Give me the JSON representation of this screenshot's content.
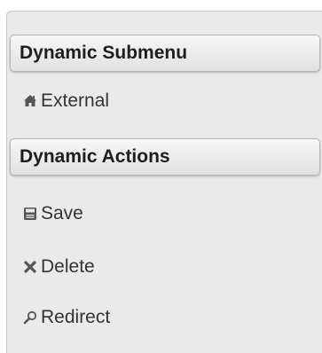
{
  "menu": {
    "sections": [
      {
        "header": "Dynamic Submenu",
        "items": [
          {
            "label": "External",
            "icon": "home-icon"
          }
        ]
      },
      {
        "header": "Dynamic Actions",
        "items": [
          {
            "label": "Save",
            "icon": "save-icon"
          },
          {
            "label": "Delete",
            "icon": "close-icon"
          },
          {
            "label": "Redirect",
            "icon": "search-icon"
          }
        ]
      }
    ]
  },
  "colors": {
    "panel_background": "#eaeaea",
    "header_gradient_top": "#f7f7f7",
    "header_gradient_bottom": "#e1e1e1",
    "text": "#333333"
  }
}
